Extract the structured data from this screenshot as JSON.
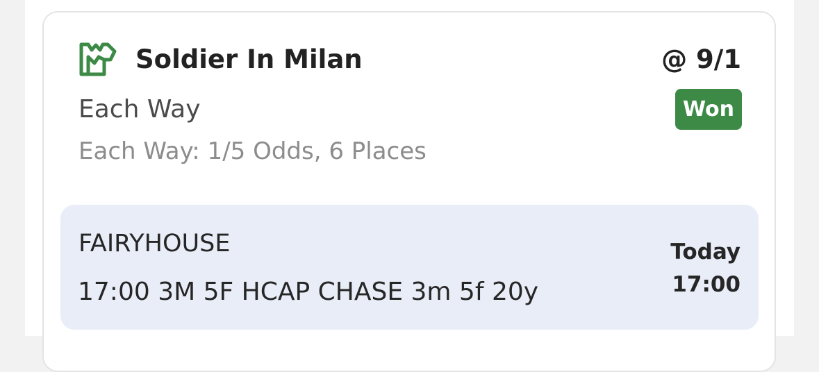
{
  "bet": {
    "selection": "Soldier In Milan",
    "odds": "@ 9/1",
    "bet_type": "Each Way",
    "terms": "Each Way: 1/5 Odds, 6 Places",
    "status": "Won",
    "status_color": "#3c8a46",
    "icon": "horse-head-icon"
  },
  "event": {
    "venue": "FAIRYHOUSE",
    "race": "17:00 3M 5F HCAP CHASE 3m 5f 20y",
    "day": "Today",
    "time": "17:00"
  }
}
